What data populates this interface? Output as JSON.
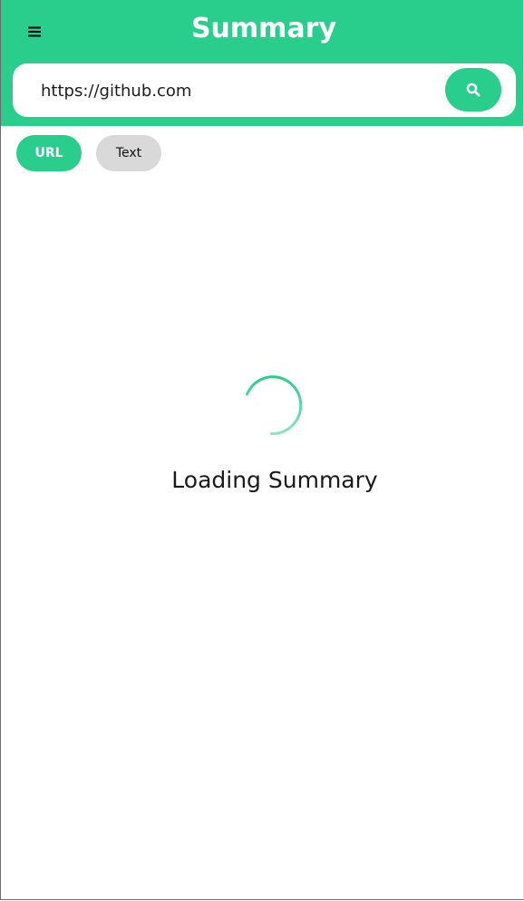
{
  "header": {
    "title": "Summary",
    "menu_icon": "hamburger-menu-icon",
    "background_color": "#2ace8c"
  },
  "search": {
    "value": "https://github.com",
    "button_icon": "search-icon"
  },
  "mode_tabs": {
    "url_label": "URL",
    "text_label": "Text",
    "selected": "URL",
    "active_color": "#2ace8c",
    "inactive_color": "#d9d9d9"
  },
  "loading": {
    "message": "Loading Summary",
    "spinner_icon": "loading-spinner-icon",
    "spinner_color": "#2ace8c"
  }
}
